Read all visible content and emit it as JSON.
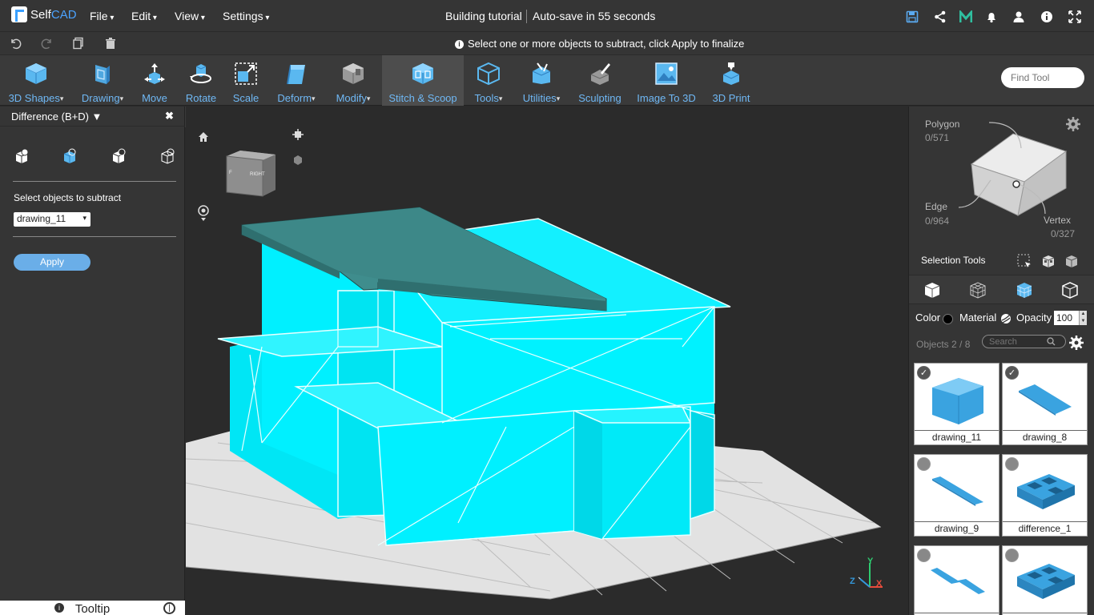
{
  "app": {
    "logo_self": "Self",
    "logo_cad": "CAD"
  },
  "menus": [
    "File",
    "Edit",
    "View",
    "Settings"
  ],
  "document": {
    "title": "Building tutorial",
    "autosave": "Auto-save in 55 seconds"
  },
  "top_icons": [
    "save-icon",
    "share-icon",
    "m-icon",
    "bell-icon",
    "user-icon",
    "info-icon",
    "fullscreen-icon"
  ],
  "hint": "Select one or more objects to subtract, click Apply to finalize",
  "toolbar": {
    "tools": [
      {
        "label": "3D Shapes",
        "dropdown": true
      },
      {
        "label": "Drawing",
        "dropdown": true
      },
      {
        "label": "Move",
        "dropdown": false
      },
      {
        "label": "Rotate",
        "dropdown": false
      },
      {
        "label": "Scale",
        "dropdown": false
      },
      {
        "label": "Deform",
        "dropdown": true
      },
      {
        "label": "Modify",
        "dropdown": true
      },
      {
        "label": "Stitch & Scoop",
        "dropdown": false,
        "active": true
      },
      {
        "label": "Tools",
        "dropdown": true
      },
      {
        "label": "Utilities",
        "dropdown": true
      },
      {
        "label": "Sculpting",
        "dropdown": false
      },
      {
        "label": "Image To 3D",
        "dropdown": false
      },
      {
        "label": "3D Print",
        "dropdown": false
      }
    ],
    "find_placeholder": "Find Tool"
  },
  "left_panel": {
    "title": "Difference (B+D) ▼",
    "close": "✖",
    "select_label": "Select objects to subtract",
    "selected_object": "drawing_11",
    "apply": "Apply",
    "tooltip": "Tooltip"
  },
  "viewcube": {
    "face_right": "RIGHT",
    "face_left": "F"
  },
  "selection": {
    "polygon_label": "Polygon",
    "polygon_value": "0/571",
    "edge_label": "Edge",
    "edge_value": "0/964",
    "vertex_label": "Vertex",
    "vertex_value": "0/327",
    "tools_label": "Selection Tools"
  },
  "properties": {
    "color": "Color",
    "material": "Material",
    "opacity": "Opacity",
    "opacity_value": "100"
  },
  "objects": {
    "count": "Objects 2 / 8",
    "search_placeholder": "Search",
    "items": [
      {
        "name": "drawing_11",
        "checked": true
      },
      {
        "name": "drawing_8",
        "checked": true
      },
      {
        "name": "drawing_9",
        "checked": false
      },
      {
        "name": "difference_1",
        "checked": false
      },
      {
        "name": "",
        "checked": false
      },
      {
        "name": "",
        "checked": false
      }
    ]
  },
  "axis": {
    "x": "X",
    "y": "Y",
    "z": "Z"
  },
  "colors": {
    "accent": "#6fb8f5",
    "model": "#00f0ff",
    "roof": "#3e8a8a",
    "panel": "#353535"
  }
}
